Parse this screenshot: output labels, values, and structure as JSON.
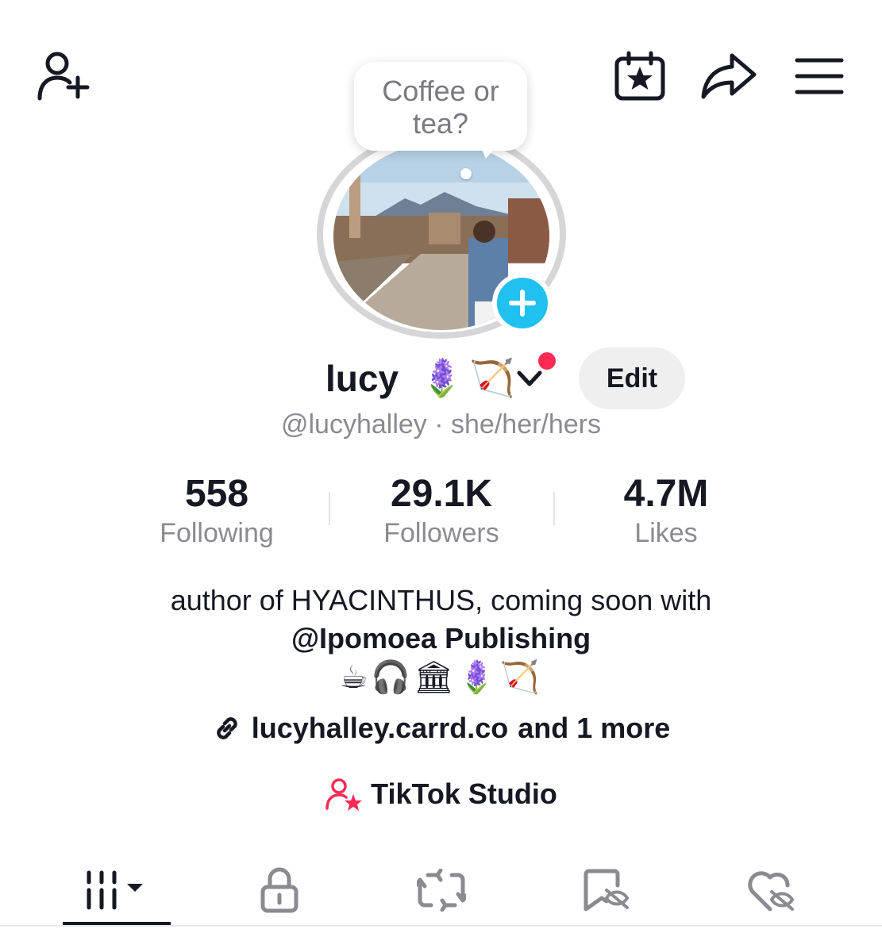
{
  "colors": {
    "accent_red": "#fe2c55",
    "add_story_blue": "#20c0f0",
    "text_primary": "#161823",
    "text_secondary": "#8a8b91"
  },
  "icons": {
    "top_left": "add-friend-icon",
    "top_right": [
      "calendar-star-icon",
      "share-icon",
      "menu-icon"
    ],
    "tabs": [
      "videos-grid-icon",
      "lock-icon",
      "repost-icon",
      "saved-hidden-icon",
      "liked-hidden-icon"
    ]
  },
  "note_bubble": {
    "line1": "Coffee or",
    "line2": "tea?"
  },
  "profile": {
    "display_name": "lucy",
    "name_emoji": "🪻🏹",
    "edit_label": "Edit",
    "handle": "@lucyhalley",
    "pronouns_sep": " · ",
    "pronouns": "she/her/hers"
  },
  "stats": [
    {
      "value": "558",
      "label": "Following"
    },
    {
      "value": "29.1K",
      "label": "Followers"
    },
    {
      "value": "4.7M",
      "label": "Likes"
    }
  ],
  "bio": {
    "line1": "author of HYACINTHUS, coming soon with",
    "line2": "@Ipomoea Publishing",
    "line3": "☕🎧🏛🪻🏹"
  },
  "links": {
    "url": "lucyhalley.carrd.co",
    "more": "and 1 more"
  },
  "studio_label": "TikTok Studio"
}
